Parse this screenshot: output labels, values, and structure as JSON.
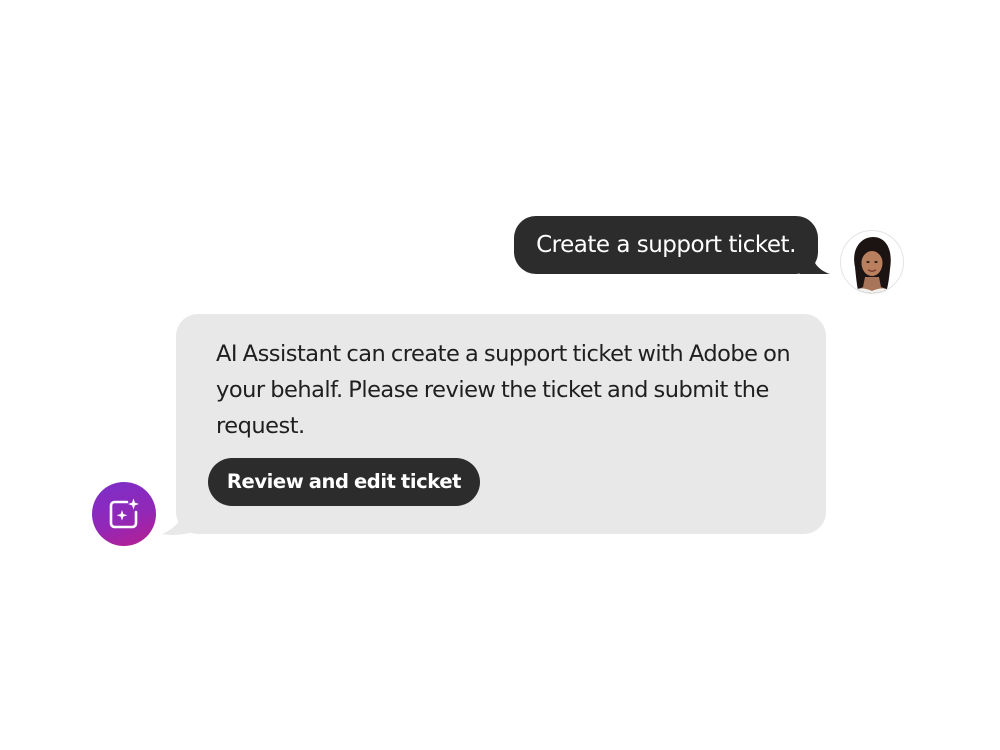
{
  "conversation": {
    "user_message": {
      "text": "Create a support ticket.",
      "avatar_icon": "user-portrait"
    },
    "assistant_message": {
      "text": "AI Assistant can create a support ticket with Adobe on your behalf. Please review the ticket and submit the request.",
      "action_label": "Review and edit ticket",
      "avatar_icon": "ai-sparkle-icon"
    }
  },
  "colors": {
    "user_bubble": "#2c2c2c",
    "assistant_bubble": "#e8e8e8",
    "button": "#2c2c2c",
    "ai_avatar_gradient_start": "#7b2fc9",
    "ai_avatar_gradient_end": "#b81f8f"
  }
}
